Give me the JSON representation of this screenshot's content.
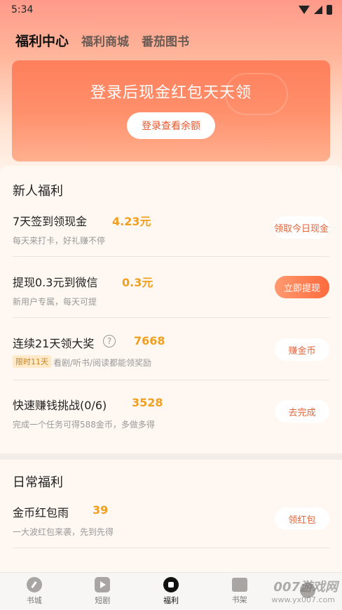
{
  "status_bar": {
    "time": "5:34"
  },
  "tabs": [
    {
      "label": "福利中心",
      "active": true
    },
    {
      "label": "福利商城",
      "active": false
    },
    {
      "label": "番茄图书",
      "active": false
    }
  ],
  "banner": {
    "title": "登录后现金红包天天领",
    "button_label": "登录查看余额"
  },
  "newbie_section": {
    "title": "新人福利",
    "tasks": [
      {
        "name": "7天签到领现金",
        "value": "4.23元",
        "desc": "每天来打卡，好礼赚不停",
        "button": "领取今日现金"
      },
      {
        "name": "提现0.3元到微信",
        "value": "0.3元",
        "desc": "新用户专属，每天可提",
        "button": "立即提现"
      },
      {
        "name": "连续21天领大奖",
        "value": "7668",
        "badge": "限时11天",
        "desc": "看剧/听书/阅读都能领奖励",
        "button": "赚金币"
      },
      {
        "name": "快速赚钱挑战(0/6)",
        "value": "3528",
        "desc": "完成一个任务可得588金币，多做多得",
        "button": "去完成"
      }
    ]
  },
  "daily_section": {
    "title": "日常福利",
    "tasks": [
      {
        "name": "金币红包雨",
        "value": "39",
        "desc": "一大波红包来袭，先到先得",
        "button": "领红包"
      }
    ]
  },
  "bottom_nav": [
    {
      "label": "书城",
      "icon": "pen-icon"
    },
    {
      "label": "短剧",
      "icon": "play-icon"
    },
    {
      "label": "福利",
      "icon": "welfare-icon",
      "active": true
    },
    {
      "label": "书架",
      "icon": "book-icon"
    },
    {
      "label": "",
      "icon": "profile-icon"
    }
  ],
  "watermark": {
    "text": "007游戏网",
    "url": "www.yx007.com"
  }
}
